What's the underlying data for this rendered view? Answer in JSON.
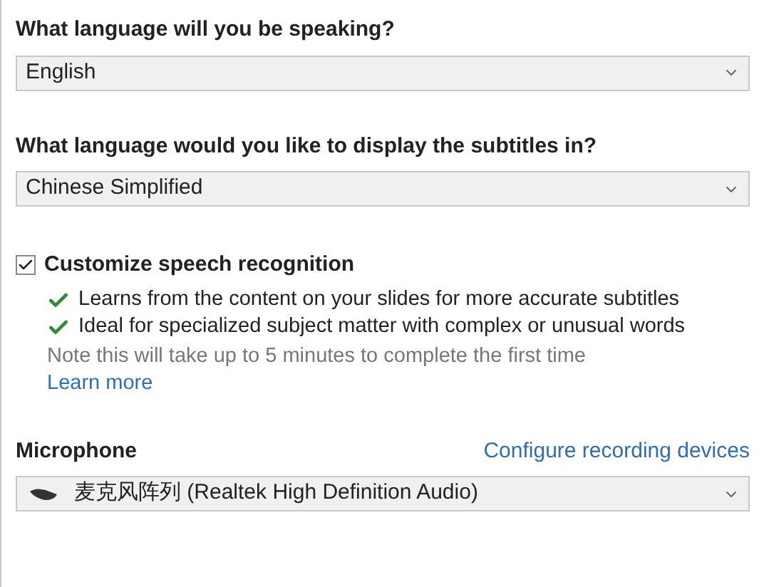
{
  "speaking": {
    "label": "What language will you be speaking?",
    "value": "English"
  },
  "subtitles": {
    "label": "What language would you like to display the subtitles in?",
    "value": "Chinese Simplified"
  },
  "customize": {
    "label": "Customize speech recognition",
    "checked": true,
    "benefits": [
      "Learns from the content on your slides for more accurate subtitles",
      "Ideal for specialized subject matter with complex or unusual words"
    ],
    "note": "Note this will take up to 5 minutes to complete the first time",
    "link": "Learn more"
  },
  "microphone": {
    "label": "Microphone",
    "link": "Configure recording devices",
    "value": "麦克风阵列 (Realtek High Definition Audio)"
  }
}
